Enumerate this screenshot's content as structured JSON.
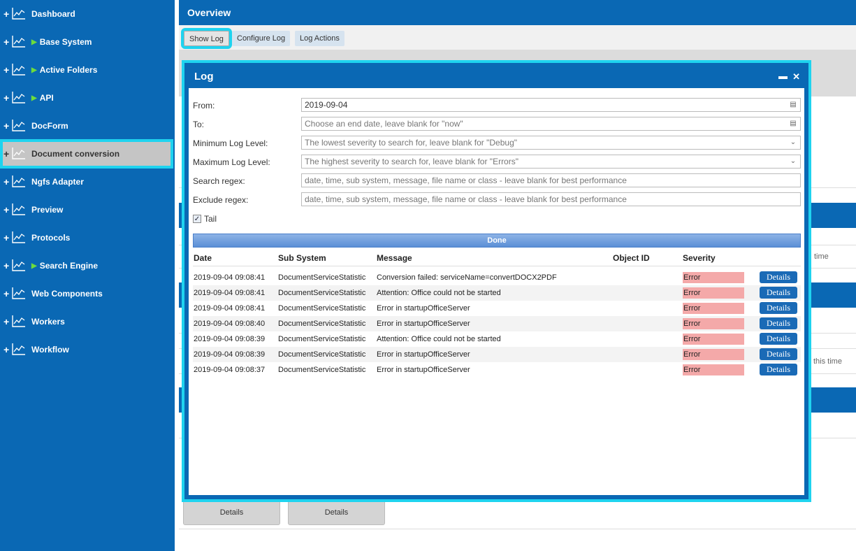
{
  "sidebar": {
    "items": [
      {
        "label": "Dashboard",
        "expandable": false
      },
      {
        "label": "Base System",
        "expandable": true
      },
      {
        "label": "Active Folders",
        "expandable": true
      },
      {
        "label": "API",
        "expandable": true
      },
      {
        "label": "DocForm",
        "expandable": false
      },
      {
        "label": "Document conversion",
        "expandable": false,
        "active": true
      },
      {
        "label": "Ngfs Adapter",
        "expandable": false
      },
      {
        "label": "Preview",
        "expandable": false
      },
      {
        "label": "Protocols",
        "expandable": false
      },
      {
        "label": "Search Engine",
        "expandable": true
      },
      {
        "label": "Web Components",
        "expandable": false
      },
      {
        "label": "Workers",
        "expandable": false
      },
      {
        "label": "Workflow",
        "expandable": false
      }
    ]
  },
  "header": {
    "title": "Overview"
  },
  "toolbar": {
    "show_log": "Show Log",
    "configure_log": "Configure Log",
    "log_actions": "Log Actions"
  },
  "background": {
    "fragment_1": "time",
    "fragment_2": "this time",
    "details_1": "Details",
    "details_2": "Details"
  },
  "log": {
    "title": "Log",
    "form": {
      "from_label": "From:",
      "from_value": "2019-09-04",
      "to_label": "To:",
      "to_placeholder": "Choose an end date, leave blank for \"now\"",
      "min_label": "Minimum Log Level:",
      "min_placeholder": "The lowest severity to search for, leave blank for \"Debug\"",
      "max_label": "Maximum Log Level:",
      "max_placeholder": "The highest severity to search for, leave blank for \"Errors\"",
      "search_label": "Search regex:",
      "search_placeholder": "date, time, sub system, message, file name or class - leave blank for best performance",
      "exclude_label": "Exclude regex:",
      "exclude_placeholder": "date, time, sub system, message, file name or class - leave blank for best performance",
      "tail_label": "Tail",
      "tail_checked": true
    },
    "done_label": "Done",
    "columns": {
      "date": "Date",
      "sub_system": "Sub System",
      "message": "Message",
      "object_id": "Object ID",
      "severity": "Severity"
    },
    "rows": [
      {
        "date": "2019-09-04 09:08:41",
        "sub_system": "DocumentServiceStatistic",
        "message": "Conversion failed: serviceName=convertDOCX2PDF",
        "object_id": "",
        "severity": "Error",
        "action": "Details"
      },
      {
        "date": "2019-09-04 09:08:41",
        "sub_system": "DocumentServiceStatistic",
        "message": "Attention: Office could not be started",
        "object_id": "",
        "severity": "Error",
        "action": "Details"
      },
      {
        "date": "2019-09-04 09:08:41",
        "sub_system": "DocumentServiceStatistic",
        "message": "Error in startupOfficeServer",
        "object_id": "",
        "severity": "Error",
        "action": "Details"
      },
      {
        "date": "2019-09-04 09:08:40",
        "sub_system": "DocumentServiceStatistic",
        "message": "Error in startupOfficeServer",
        "object_id": "",
        "severity": "Error",
        "action": "Details"
      },
      {
        "date": "2019-09-04 09:08:39",
        "sub_system": "DocumentServiceStatistic",
        "message": "Attention: Office could not be started",
        "object_id": "",
        "severity": "Error",
        "action": "Details"
      },
      {
        "date": "2019-09-04 09:08:39",
        "sub_system": "DocumentServiceStatistic",
        "message": "Error in startupOfficeServer",
        "object_id": "",
        "severity": "Error",
        "action": "Details"
      },
      {
        "date": "2019-09-04 09:08:37",
        "sub_system": "DocumentServiceStatistic",
        "message": "Error in startupOfficeServer",
        "object_id": "",
        "severity": "Error",
        "action": "Details"
      }
    ]
  },
  "colors": {
    "primary": "#0a68b4",
    "highlight": "#1fd3ef",
    "error_bg": "#f4a9a9",
    "expand_arrow": "#6ddc3c"
  }
}
